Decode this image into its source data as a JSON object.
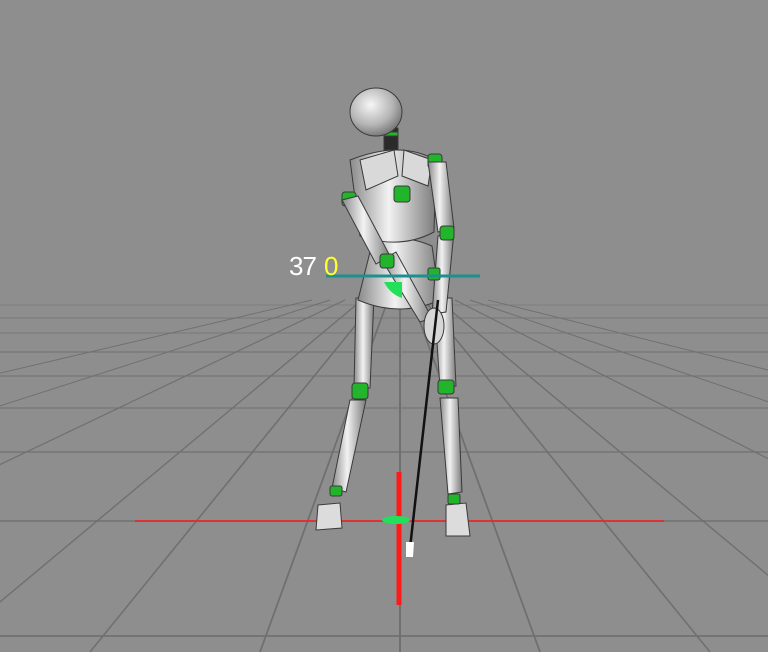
{
  "hud": {
    "angle_a": "37",
    "angle_b": "0"
  },
  "colors": {
    "background": "#8e8e8e",
    "floor_grid": "#6f6f6f",
    "robot_body": "#c9c9c9",
    "robot_joint": "#22b42a",
    "target_line": "#ff1a1a",
    "shoulder_line": "#1c8f8f",
    "angle_a_text": "#ffffff",
    "angle_b_text": "#ffff33",
    "club_shaft": "#111111",
    "ball_marker": "#22e05a"
  },
  "icons": {
    "figure": "golfer-robot",
    "club": "golf-club-icon"
  }
}
